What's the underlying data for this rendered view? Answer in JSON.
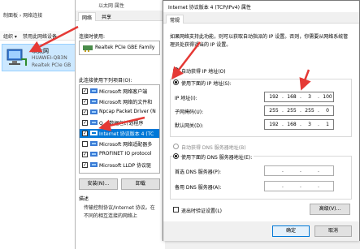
{
  "network_window": {
    "breadcrumb": "制面板 › 网络连接",
    "toolbar": {
      "organize": "组织 ▾",
      "disable": "禁用此网络设备"
    },
    "adapter": {
      "name": "以太网",
      "host": "HUAWEI-QB3N",
      "device": "Realtek PCIe GB"
    }
  },
  "properties_window": {
    "title": "以太网 属性",
    "tabs": [
      "网络",
      "共享"
    ],
    "connect_using_label": "连接时使用:",
    "nic_name": "Realtek PCIe GBE Family",
    "items_label": "此连接使用下列项目(O):",
    "items": [
      {
        "label": "Microsoft 网络客户端",
        "checked": true,
        "selected": false
      },
      {
        "label": "Microsoft 网络的文件和",
        "checked": true,
        "selected": false
      },
      {
        "label": "Npcap Packet Driver (N",
        "checked": true,
        "selected": false
      },
      {
        "label": "Q... 数据包计划程序",
        "checked": true,
        "selected": false
      },
      {
        "label": "Internet 协议版本 4 (TC",
        "checked": true,
        "selected": true
      },
      {
        "label": "Microsoft 网络适配器多",
        "checked": false,
        "selected": false
      },
      {
        "label": "PROFINET IO protocol",
        "checked": true,
        "selected": false
      },
      {
        "label": "Microsoft LLDP 协议驱",
        "checked": true,
        "selected": false
      }
    ],
    "install_button": "安装(N)...",
    "uninstall_button": "卸载",
    "description_label": "描述",
    "description_text": "传输控制协议/Internet 协议。在不同的相互连接的网络上"
  },
  "ipv4_dialog": {
    "title": "Internet 协议版本 4 (TCP/IPv4) 属性",
    "tab": "常规",
    "intro": "如果网络支持此功能，则可以获取自动指派的 IP 设置。否则，你需要从网络系统管理员处获得适当的 IP 设置。",
    "auto_ip_label": "自动获得 IP 地址(O)",
    "manual_ip_label": "使用下面的 IP 地址(S):",
    "ip_label": "IP 地址(I):",
    "ip_value": [
      "192",
      "168",
      "3",
      "100"
    ],
    "subnet_label": "子网掩码(U):",
    "subnet_value": [
      "255",
      "255",
      "255",
      "0"
    ],
    "gateway_label": "默认网关(D):",
    "gateway_value": [
      "192",
      "168",
      "3",
      "1"
    ],
    "auto_dns_label": "自动获得 DNS 服务器地址(B)",
    "manual_dns_label": "使用下面的 DNS 服务器地址(E):",
    "preferred_dns_label": "首选 DNS 服务器(P):",
    "alternate_dns_label": "备用 DNS 服务器(A):",
    "validate_label": "退出时验证设置(L)",
    "advanced_button": "高级(V)...",
    "ok_button": "确定",
    "cancel_button": "取消"
  },
  "colors": {
    "selection": "#0078d7",
    "arrow": "#e53935",
    "adapter_highlight": "#cce8ff"
  },
  "icons": [
    "computer-network-icon",
    "network-adapter-icon",
    "protocol-icon"
  ]
}
